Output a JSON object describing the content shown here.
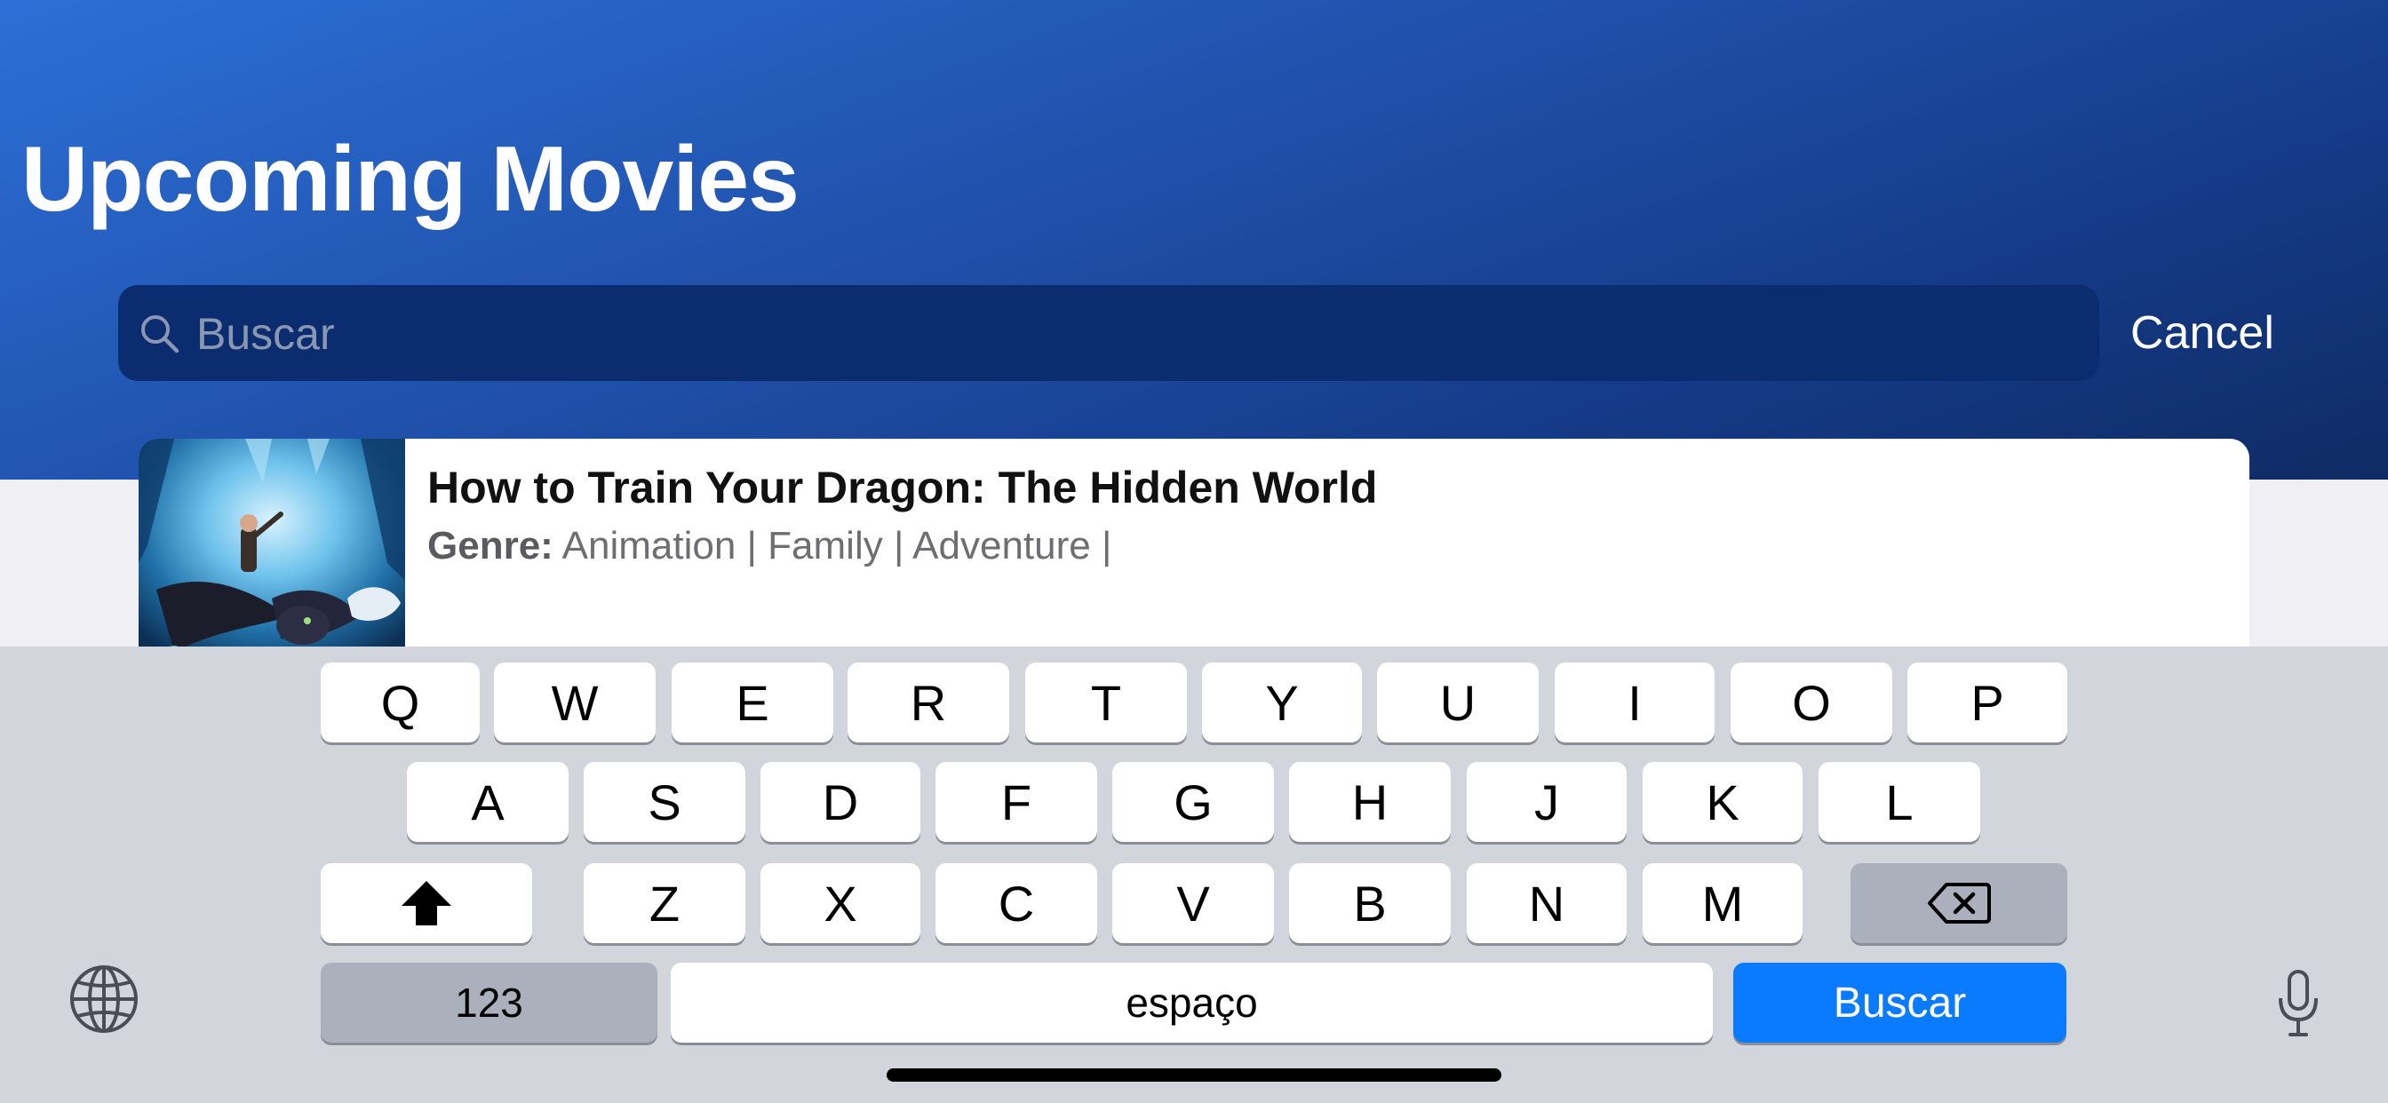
{
  "header": {
    "title": "Upcoming Movies"
  },
  "search": {
    "placeholder": "Buscar",
    "cancel_label": "Cancel"
  },
  "results": [
    {
      "title": "How to Train Your Dragon: The Hidden World",
      "genre_label": "Genre:",
      "genres": "Animation | Family | Adventure |"
    }
  ],
  "keyboard": {
    "row1": [
      "Q",
      "W",
      "E",
      "R",
      "T",
      "Y",
      "U",
      "I",
      "O",
      "P"
    ],
    "row2": [
      "A",
      "S",
      "D",
      "F",
      "G",
      "H",
      "J",
      "K",
      "L"
    ],
    "row3": [
      "Z",
      "X",
      "C",
      "V",
      "B",
      "N",
      "M"
    ],
    "numbers_label": "123",
    "space_label": "espaço",
    "return_label": "Buscar",
    "icons": [
      "shift-icon",
      "backspace-icon",
      "globe-icon",
      "microphone-icon"
    ]
  },
  "colors": {
    "accent": "#0a7bff",
    "header_gradient_start": "#2c6fd6",
    "header_gradient_end": "#0f2b63"
  }
}
